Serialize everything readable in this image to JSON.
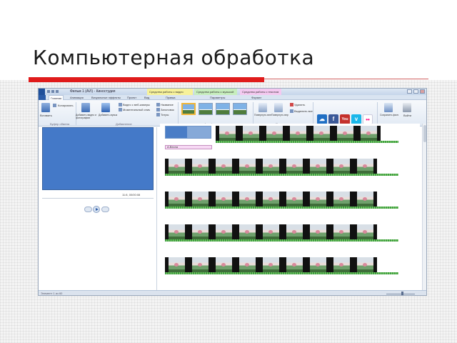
{
  "slide": {
    "title": "Компьютерная обработка"
  },
  "window": {
    "title": "Фильм 1 (AVI) - Киностудия",
    "context_tabs": [
      "Средства работы с видео",
      "Средства работы с музыкой",
      "Средства работы с текстом"
    ]
  },
  "ribbon": {
    "tabs": [
      "Главная",
      "Анимация",
      "Визуальные эффекты",
      "Проект",
      "Вид",
      "Правка",
      "Параметры",
      "Формат"
    ],
    "buttons": {
      "paste": "Вставить",
      "copy": "Копировать",
      "add": "Добавить видео и фотографии",
      "music": "Добавить музыку",
      "webcam": "Видео с веб-камеры",
      "snapshot": "Моментальный снимок",
      "title": "Название",
      "caption": "Заголовок",
      "credits": "Титры",
      "rotate_left": "Повернуть влево",
      "rotate_right": "Повернуть вправо",
      "remove": "Удалить",
      "select_all": "Выделить все",
      "save_movie": "Сохранить фильм",
      "signin": "Войти"
    },
    "group_labels": [
      "Буфер обмена",
      "Добавление",
      "Автофильм",
      "Правка",
      "Общий доступ"
    ]
  },
  "preview": {
    "timecode": "11:8, 00/00:08"
  },
  "storyboard": {
    "caption_text": "А.Весна"
  },
  "status": {
    "text": "Элемент 1 из 60"
  },
  "colors": {
    "accent_red": "#e01b1b",
    "preview_blue": "#4479c8",
    "ribbon_bg": "#e2eaf4"
  },
  "icons": {
    "services": [
      "skydrive-icon",
      "facebook-icon",
      "youtube-icon",
      "vimeo-icon",
      "flickr-icon"
    ]
  }
}
